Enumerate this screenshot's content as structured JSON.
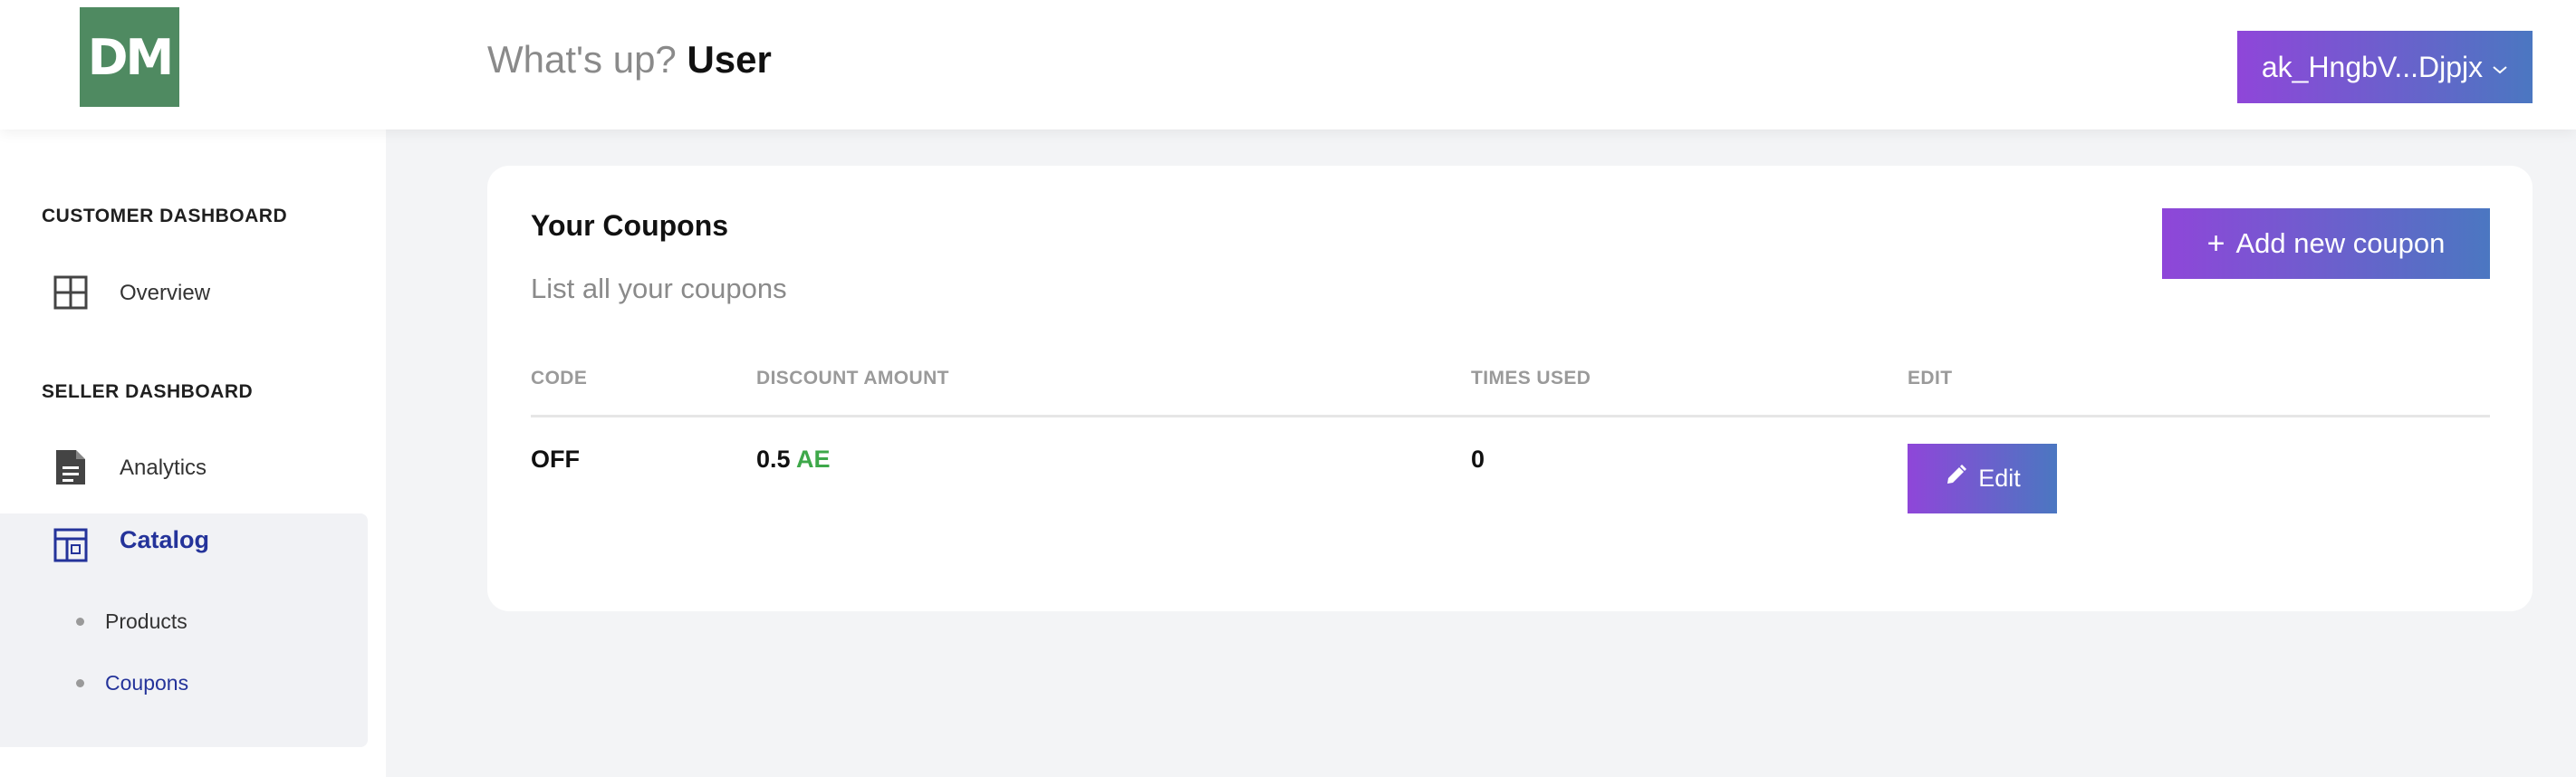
{
  "header": {
    "logo_text": "DM",
    "greeting_text": "What's up?",
    "greeting_user": "User",
    "account_label": "ak_HngbV...Djpjx",
    "account_chevron_icon": "chevron-down-icon"
  },
  "sidebar": {
    "customer_section_title": "CUSTOMER DASHBOARD",
    "seller_section_title": "SELLER DASHBOARD",
    "items": {
      "overview": {
        "label": "Overview",
        "icon": "grid-icon"
      },
      "analytics": {
        "label": "Analytics",
        "icon": "document-icon"
      },
      "catalog": {
        "label": "Catalog",
        "icon": "layout-icon",
        "active": true
      }
    },
    "catalog_subitems": [
      {
        "label": "Products",
        "active": false
      },
      {
        "label": "Coupons",
        "active": true
      }
    ]
  },
  "coupons": {
    "title": "Your Coupons",
    "subtitle": "List all your coupons",
    "add_button_label": "Add new coupon",
    "add_button_icon": "plus-icon",
    "columns": [
      "CODE",
      "DISCOUNT AMOUNT",
      "TIMES USED",
      "EDIT"
    ],
    "rows": [
      {
        "code": "OFF",
        "discount_value": "0.5",
        "discount_currency": "AE",
        "times_used": "0",
        "edit_label": "Edit",
        "edit_icon": "pencil-icon"
      }
    ]
  },
  "colors": {
    "accent_gradient_start": "#8f46d9",
    "accent_gradient_end": "#4b77c1",
    "logo_bg": "#4f8a61",
    "active_nav": "#24339a",
    "currency": "#3ea84a"
  }
}
